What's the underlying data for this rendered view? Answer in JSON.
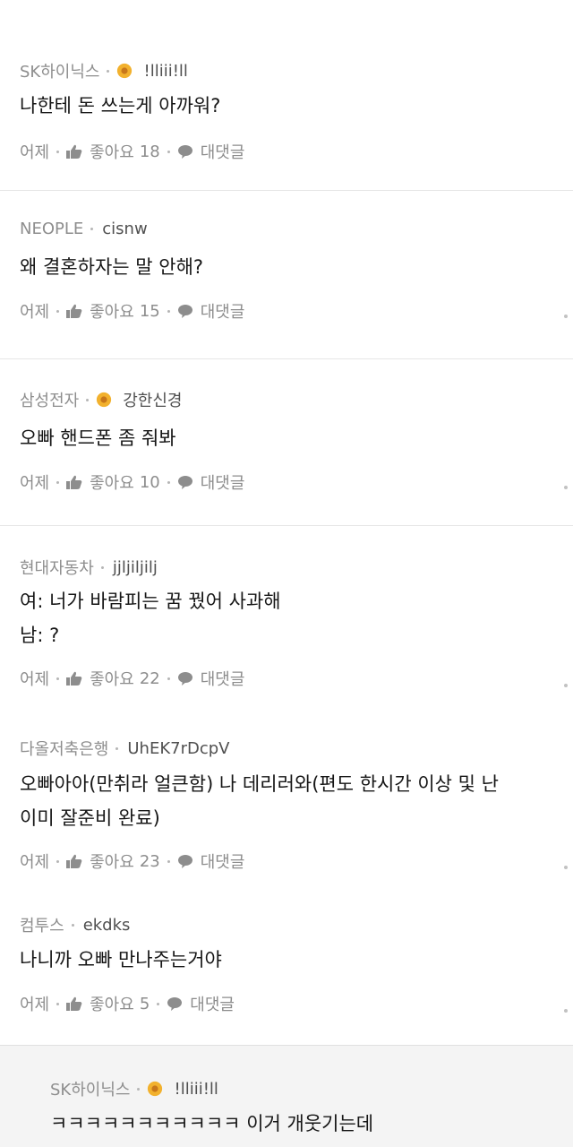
{
  "comments": [
    {
      "company": "SK하이닉스",
      "nickname": "!lliii!ll",
      "has_badge": true,
      "lines": [
        "나한테 돈 쓰는게 아까워?"
      ],
      "time": "어제",
      "like_label": "좋아요",
      "like_count": "18",
      "reply_label": "대댓글"
    },
    {
      "company": "NEOPLE",
      "nickname": "cisnw",
      "has_badge": false,
      "lines": [
        "왜 결혼하자는 말 안해?"
      ],
      "time": "어제",
      "like_label": "좋아요",
      "like_count": "15",
      "reply_label": "대댓글"
    },
    {
      "company": "삼성전자",
      "nickname": "강한신경",
      "has_badge": true,
      "lines": [
        "오빠 핸드폰 좀 줘봐"
      ],
      "time": "어제",
      "like_label": "좋아요",
      "like_count": "10",
      "reply_label": "대댓글"
    },
    {
      "company": "현대자동차",
      "nickname": "jjljiljilj",
      "has_badge": false,
      "lines": [
        "여: 너가 바람피는 꿈 꿨어 사과해",
        "남: ?"
      ],
      "time": "어제",
      "like_label": "좋아요",
      "like_count": "22",
      "reply_label": "대댓글"
    },
    {
      "company": "다올저축은행",
      "nickname": "UhEK7rDcpV",
      "has_badge": false,
      "lines": [
        "오빠아아(만취라 얼큰함) 나 데리러와(편도 한시간 이상 및 난",
        "이미 잘준비 완료)"
      ],
      "time": "어제",
      "like_label": "좋아요",
      "like_count": "23",
      "reply_label": "대댓글"
    },
    {
      "company": "컴투스",
      "nickname": "ekdks",
      "has_badge": false,
      "lines": [
        "나니까 오빠 만나주는거야"
      ],
      "time": "어제",
      "like_label": "좋아요",
      "like_count": "5",
      "reply_label": "대댓글"
    }
  ],
  "reply": {
    "company": "SK하이닉스",
    "nickname": "!lliii!ll",
    "has_badge": true,
    "lines": [
      "ㅋㅋㅋㅋㅋㅋㅋㅋㅋㅋㅋ 이거 개웃기는데"
    ]
  },
  "colors": {
    "badge": "#f2b12d",
    "text": "#161616",
    "meta": "#8a8a8a",
    "separator": "#e6e6e6",
    "reply_bg": "#f4f4f4"
  },
  "icons": {
    "badge": "sunflower-badge-icon",
    "like": "thumbs-up-icon",
    "reply": "speech-bubble-icon",
    "more": "more-dot-icon"
  }
}
